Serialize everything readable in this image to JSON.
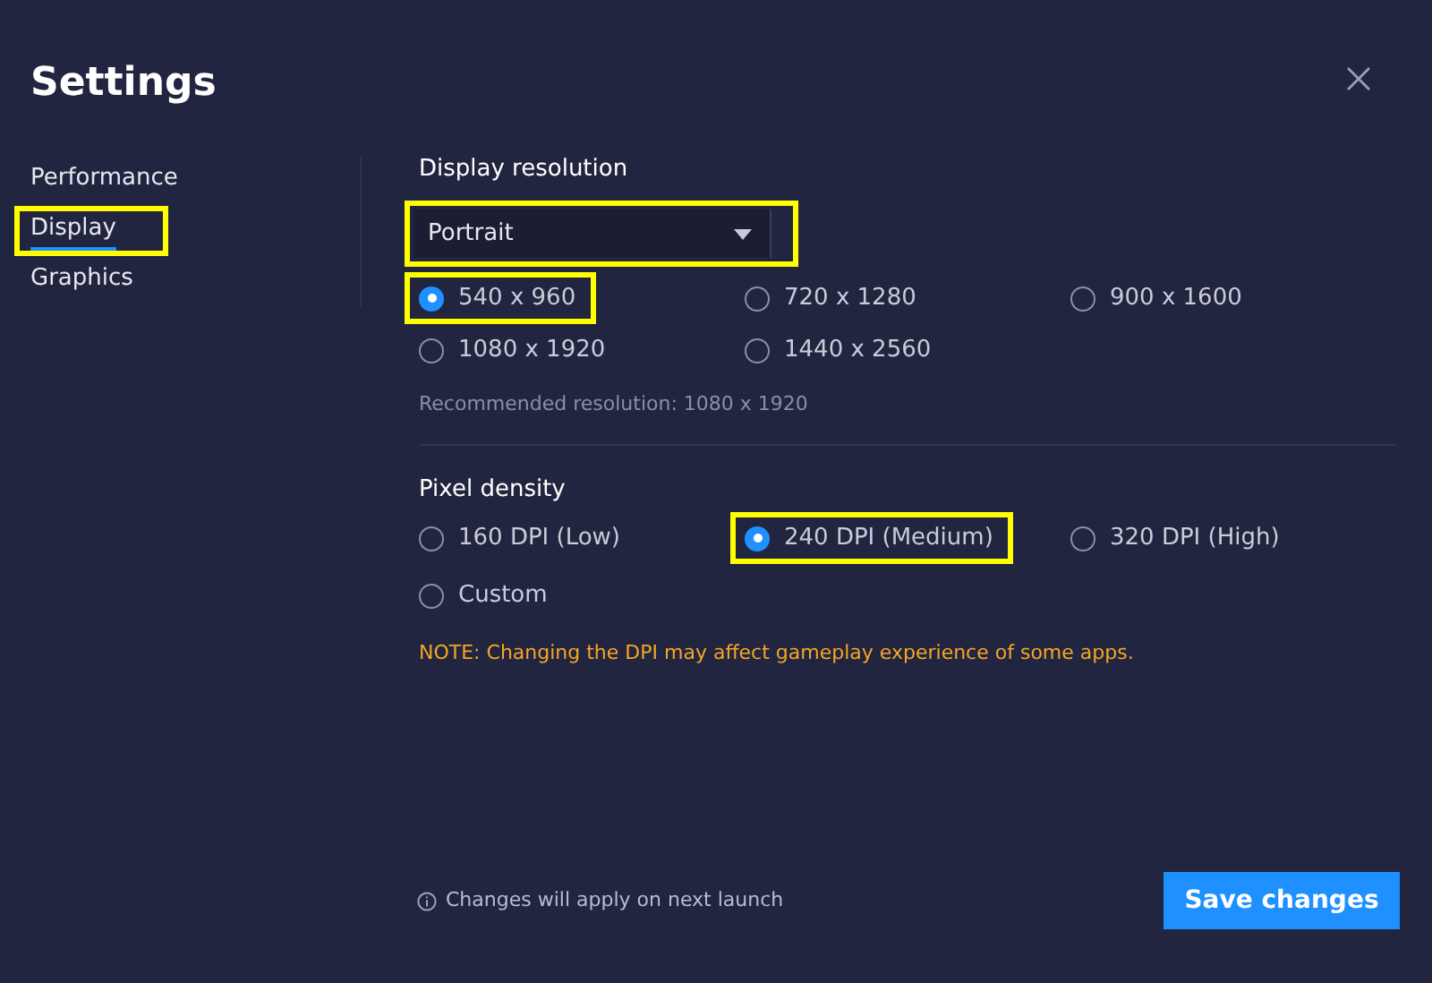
{
  "title": "Settings",
  "sidebar": {
    "items": [
      {
        "label": "Performance",
        "selected": false,
        "highlighted": false
      },
      {
        "label": "Display",
        "selected": true,
        "highlighted": true
      },
      {
        "label": "Graphics",
        "selected": false,
        "highlighted": false
      }
    ]
  },
  "display_resolution": {
    "label": "Display resolution",
    "dropdown": {
      "value": "Portrait",
      "highlighted": true
    },
    "options": [
      {
        "label": "540 x 960",
        "selected": true,
        "highlighted": true
      },
      {
        "label": "720 x 1280",
        "selected": false,
        "highlighted": false
      },
      {
        "label": "900 x 1600",
        "selected": false,
        "highlighted": false
      },
      {
        "label": "1080 x 1920",
        "selected": false,
        "highlighted": false
      },
      {
        "label": "1440 x 2560",
        "selected": false,
        "highlighted": false
      }
    ],
    "hint": "Recommended resolution: 1080 x 1920"
  },
  "pixel_density": {
    "label": "Pixel density",
    "options": [
      {
        "label": "160 DPI (Low)",
        "selected": false,
        "highlighted": false
      },
      {
        "label": "240 DPI (Medium)",
        "selected": true,
        "highlighted": true
      },
      {
        "label": "320 DPI (High)",
        "selected": false,
        "highlighted": false
      },
      {
        "label": "Custom",
        "selected": false,
        "highlighted": false
      }
    ],
    "note": "NOTE: Changing the DPI may affect gameplay experience of some apps."
  },
  "footer": {
    "info": "Changes will apply on next launch",
    "button": "Save changes"
  }
}
